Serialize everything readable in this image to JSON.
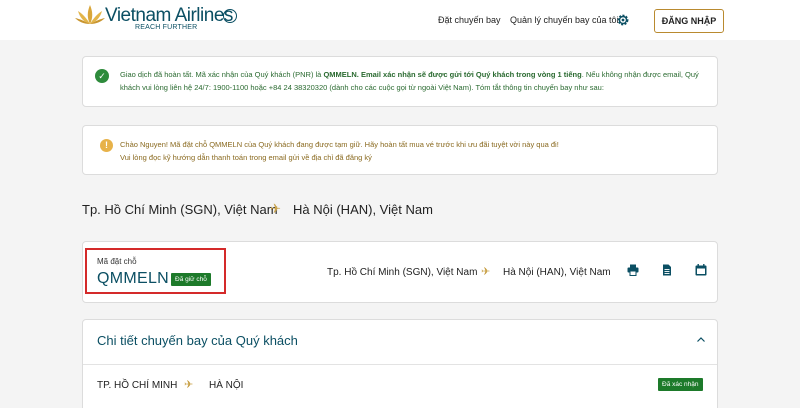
{
  "header": {
    "brand_name": "Vietnam Airlines",
    "brand_tagline": "REACH FURTHER",
    "nav": [
      {
        "label": "Đặt chuyến bay"
      },
      {
        "label": "Quản lý chuyến bay của tôi"
      }
    ],
    "settings_icon": "gear-icon",
    "login_label": "ĐĂNG NHẬP"
  },
  "success_notice": {
    "icon": "check-circle-icon",
    "part1": "Giao dịch đã hoàn tất. Mã xác nhận của Quý khách (PNR) là ",
    "pnr": "QMMELN",
    "part2": ". Email xác nhận sẽ được gửi tới Quý khách trong vòng 1 tiếng",
    "part3": ". Nếu không nhận được email, Quý khách vui lòng liên hệ 24/7: 1900-1100 hoặc +84 24 38320320 (dành cho các cuộc gọi từ ngoài Việt Nam). Tóm tắt thông tin chuyến bay như sau:"
  },
  "warning_notice": {
    "icon": "warning-circle-icon",
    "line1": "Chào Nguyen! Mã đặt chỗ QMMELN của Quý khách đang được tạm giữ. Hãy hoàn tất mua vé trước khi ưu đãi tuyệt vời này qua đi!",
    "line2": "Vui lòng đọc kỹ hướng dẫn thanh toán trong email gửi về địa chỉ đã đăng ký"
  },
  "route": {
    "from": "Tp. Hồ Chí Minh (SGN), Việt Nam",
    "to": "Hà Nội (HAN), Việt Nam"
  },
  "booking": {
    "label": "Mã đặt chỗ",
    "code": "QMMELN",
    "status": "Đã giữ chỗ",
    "from": "Tp. Hồ Chí Minh (SGN), Việt Nam",
    "to": "Hà Nội (HAN), Việt Nam",
    "actions": [
      "print-icon",
      "document-icon",
      "calendar-icon"
    ]
  },
  "details": {
    "title": "Chi tiết chuyến bay của Quý khách",
    "segment": {
      "from": "TP. HỒ CHÍ MINH",
      "to": "HÀ NỘI",
      "status": "Đã xác nhận"
    }
  },
  "colors": {
    "brand": "#0b4f63",
    "gold": "#c9a24a",
    "success": "#1d7a2a",
    "highlight_border": "#d42a2a"
  }
}
